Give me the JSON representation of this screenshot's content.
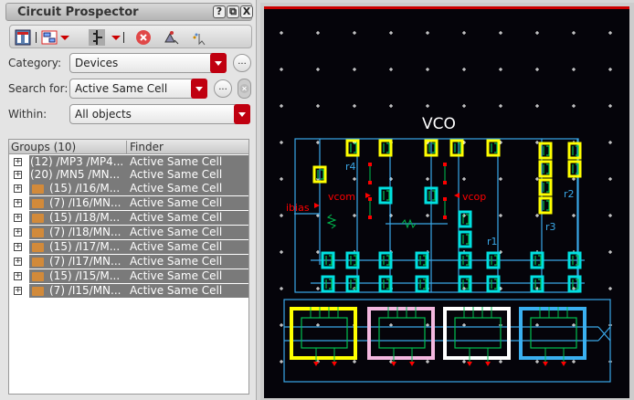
{
  "panel": {
    "title": "Circuit Prospector",
    "help": "?",
    "restore": "⧉",
    "close": "X",
    "toolbar": [
      "probe-icon",
      "select-group-icon",
      "dropdown-icon",
      "net-icon",
      "dropdown-icon",
      "clear-icon",
      "find-icon",
      "pointer-icon"
    ],
    "category_label": "Category:",
    "category_value": "Devices",
    "search_label": "Search for:",
    "search_value": "Active Same Cell",
    "within_label": "Within:",
    "within_value": "All objects",
    "more": "..."
  },
  "tree": {
    "headers": [
      "Groups (10)",
      "Finder"
    ],
    "rows": [
      {
        "group": "(12) /MP3 /MP4...",
        "finder": "Active Same Cell",
        "folder": false
      },
      {
        "group": "(20) /MN5 /MN...",
        "finder": "Active Same Cell",
        "folder": false
      },
      {
        "group": "(15) /I16/M...",
        "finder": "Active Same Cell",
        "folder": true
      },
      {
        "group": "(7) /I16/MN...",
        "finder": "Active Same Cell",
        "folder": true
      },
      {
        "group": "(15) /I18/M...",
        "finder": "Active Same Cell",
        "folder": true
      },
      {
        "group": "(7) /I18/MN...",
        "finder": "Active Same Cell",
        "folder": true
      },
      {
        "group": "(15) /I17/M...",
        "finder": "Active Same Cell",
        "folder": true
      },
      {
        "group": "(7) /I17/MN...",
        "finder": "Active Same Cell",
        "folder": true
      },
      {
        "group": "(15) /I15/M...",
        "finder": "Active Same Cell",
        "folder": true
      },
      {
        "group": "(7) /I15/MN...",
        "finder": "Active Same Cell",
        "folder": true
      }
    ]
  },
  "schematic": {
    "title": "VCO",
    "labels": {
      "vcom": "vcom",
      "vcop": "vcop",
      "ibias": "ibias",
      "r1": "r1",
      "r2": "r2",
      "r3": "r3",
      "r4": "r4"
    },
    "colors": {
      "wire": "#3aa8e8",
      "highlight_a": "#ffff00",
      "highlight_b": "#00e0e0",
      "pin": "#ff0000",
      "device": "#00c050",
      "background": "#05040a"
    }
  }
}
